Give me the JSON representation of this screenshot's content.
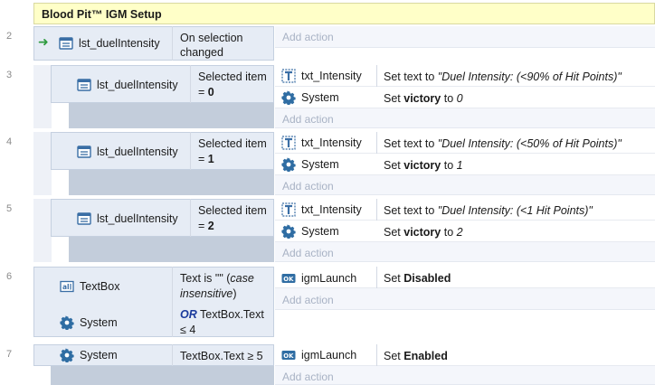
{
  "group_title": "Blood Pit™ IGM Setup",
  "add_action": "Add action",
  "line_numbers": [
    "2",
    "3",
    "4",
    "5",
    "6",
    "7"
  ],
  "event2": {
    "object": "lst_duelIntensity",
    "condition": "On selection changed"
  },
  "sub_events": [
    {
      "object": "lst_duelIntensity",
      "cond_text": "Selected item =",
      "cond_value": "0",
      "actions": [
        {
          "object": "txt_Intensity",
          "prefix": "Set text to ",
          "value": "\"Duel Intensity: (<90% of Hit Points)\""
        },
        {
          "object": "System",
          "prefix": "Set ",
          "bold": "victory",
          "mid": " to ",
          "value": "0"
        }
      ]
    },
    {
      "object": "lst_duelIntensity",
      "cond_text": "Selected item =",
      "cond_value": "1",
      "actions": [
        {
          "object": "txt_Intensity",
          "prefix": "Set text to ",
          "value": "\"Duel Intensity: (<50% of Hit Points)\""
        },
        {
          "object": "System",
          "prefix": "Set ",
          "bold": "victory",
          "mid": " to ",
          "value": "1"
        }
      ]
    },
    {
      "object": "lst_duelIntensity",
      "cond_text": "Selected item =",
      "cond_value": "2",
      "actions": [
        {
          "object": "txt_Intensity",
          "prefix": "Set text to ",
          "value": "\"Duel Intensity: (<1 Hit Points)\""
        },
        {
          "object": "System",
          "prefix": "Set ",
          "bold": "victory",
          "mid": " to ",
          "value": "2"
        }
      ]
    }
  ],
  "event6": {
    "cond1_object": "TextBox",
    "cond1_text": "Text is \"\" (",
    "cond1_italic": "case insensitive",
    "cond1_end": ")",
    "cond2_object": "System",
    "cond2_or": "OR",
    "cond2_text": "TextBox.Text ≤ 4",
    "action_object": "igmLaunch",
    "action_prefix": "Set ",
    "action_bold": "Disabled"
  },
  "event7": {
    "cond_object": "System",
    "cond_text": "TextBox.Text ≥ 5",
    "action_object": "igmLaunch",
    "action_prefix": "Set ",
    "action_bold": "Enabled"
  },
  "icons": {
    "list": "list-icon",
    "text": "text-object-icon",
    "system": "gear-icon",
    "textbox": "textbox-icon",
    "button": "button-ok-icon"
  },
  "colors": {
    "group_bg": "#ffffc8",
    "condition_bg": "#e6ecf5",
    "spacer": "#c3cddb",
    "trigger_arrow": "#2e9b3e",
    "or_text": "#1a3a9c"
  }
}
